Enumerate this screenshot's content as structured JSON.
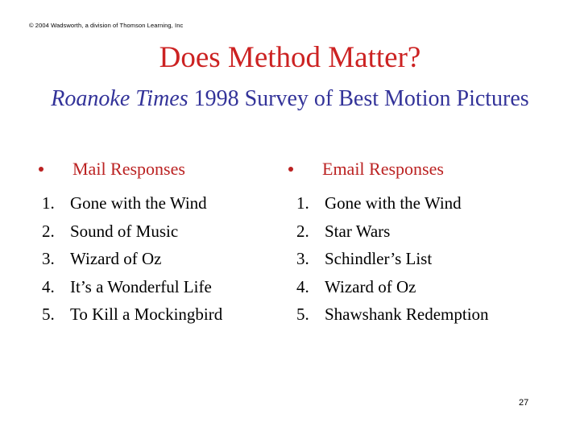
{
  "slide": {
    "background_color": "#FFFFFF",
    "copyright": "© 2004 Wadsworth, a division of Thomson Learning, Inc",
    "title": "Does Method Matter?",
    "title_color": "#CC2222",
    "subtitle": {
      "italic_part": "Roanoke Times",
      "rest": " 1998 Survey of Best Motion Pictures",
      "color": "#333399"
    },
    "page_number": "27"
  },
  "columns": [
    {
      "heading": "Mail Responses",
      "heading_color": "#BB2222",
      "bullet": "round-bullet",
      "items": [
        {
          "num": "1.",
          "label": "Gone with the Wind"
        },
        {
          "num": "2.",
          "label": "Sound of Music"
        },
        {
          "num": "3.",
          "label": "Wizard of Oz"
        },
        {
          "num": "4.",
          "label": "It’s a Wonderful Life"
        },
        {
          "num": "5.",
          "label": "To Kill a Mockingbird"
        }
      ]
    },
    {
      "heading": "Email Responses",
      "heading_color": "#BB2222",
      "bullet": "round-bullet",
      "items": [
        {
          "num": "1.",
          "label": "Gone with the Wind"
        },
        {
          "num": "2.",
          "label": "Star Wars"
        },
        {
          "num": "3.",
          "label": "Schindler’s List"
        },
        {
          "num": "4.",
          "label": "Wizard of Oz"
        },
        {
          "num": "5.",
          "label": "Shawshank Redemption"
        }
      ]
    }
  ]
}
